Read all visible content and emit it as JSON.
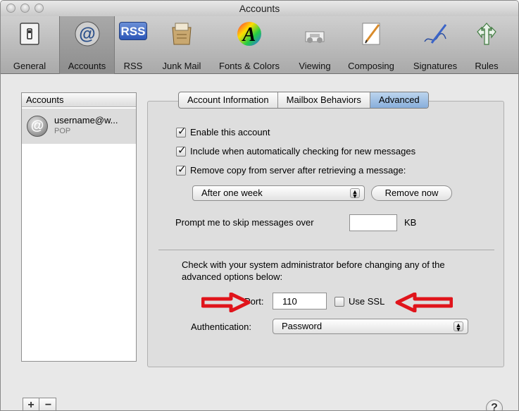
{
  "window": {
    "title": "Accounts"
  },
  "toolbar": {
    "items": [
      {
        "label": "General",
        "icon": "general-switch-icon"
      },
      {
        "label": "Accounts",
        "icon": "at-sign-icon",
        "selected": true
      },
      {
        "label": "RSS",
        "icon": "rss-icon"
      },
      {
        "label": "Junk Mail",
        "icon": "junk-mail-icon"
      },
      {
        "label": "Fonts & Colors",
        "icon": "fonts-colors-icon"
      },
      {
        "label": "Viewing",
        "icon": "viewing-icon"
      },
      {
        "label": "Composing",
        "icon": "composing-icon"
      },
      {
        "label": "Signatures",
        "icon": "signatures-icon"
      },
      {
        "label": "Rules",
        "icon": "rules-icon"
      }
    ],
    "rss_badge": "RSS",
    "fonts_letter": "A"
  },
  "accounts": {
    "header": "Accounts",
    "items": [
      {
        "name": "username@w...",
        "type": "POP",
        "avatar_glyph": "@"
      }
    ],
    "add_label": "+",
    "remove_label": "−"
  },
  "tabs": [
    {
      "label": "Account Information"
    },
    {
      "label": "Mailbox Behaviors"
    },
    {
      "label": "Advanced",
      "active": true
    }
  ],
  "advanced": {
    "enable_account": {
      "label": "Enable this account",
      "checked": true
    },
    "include_auto_check": {
      "label": "Include when automatically checking for new messages",
      "checked": true
    },
    "remove_copy": {
      "label": "Remove copy from server after retrieving a message:",
      "checked": true
    },
    "retention_value": "After one week",
    "remove_now_label": "Remove now",
    "prompt_label": "Prompt me to skip messages over",
    "prompt_value": "",
    "kb_label": "KB",
    "note": "Check with your system administrator before changing any of the advanced options below:",
    "port_label": "Port:",
    "port_value": "110",
    "use_ssl": {
      "label": "Use SSL",
      "checked": false
    },
    "auth_label": "Authentication:",
    "auth_value": "Password"
  },
  "help_label": "?",
  "check_glyph": "✓",
  "colors": {
    "tab_active": "#9ab9e3",
    "annotation_arrow": "#e0141b"
  }
}
